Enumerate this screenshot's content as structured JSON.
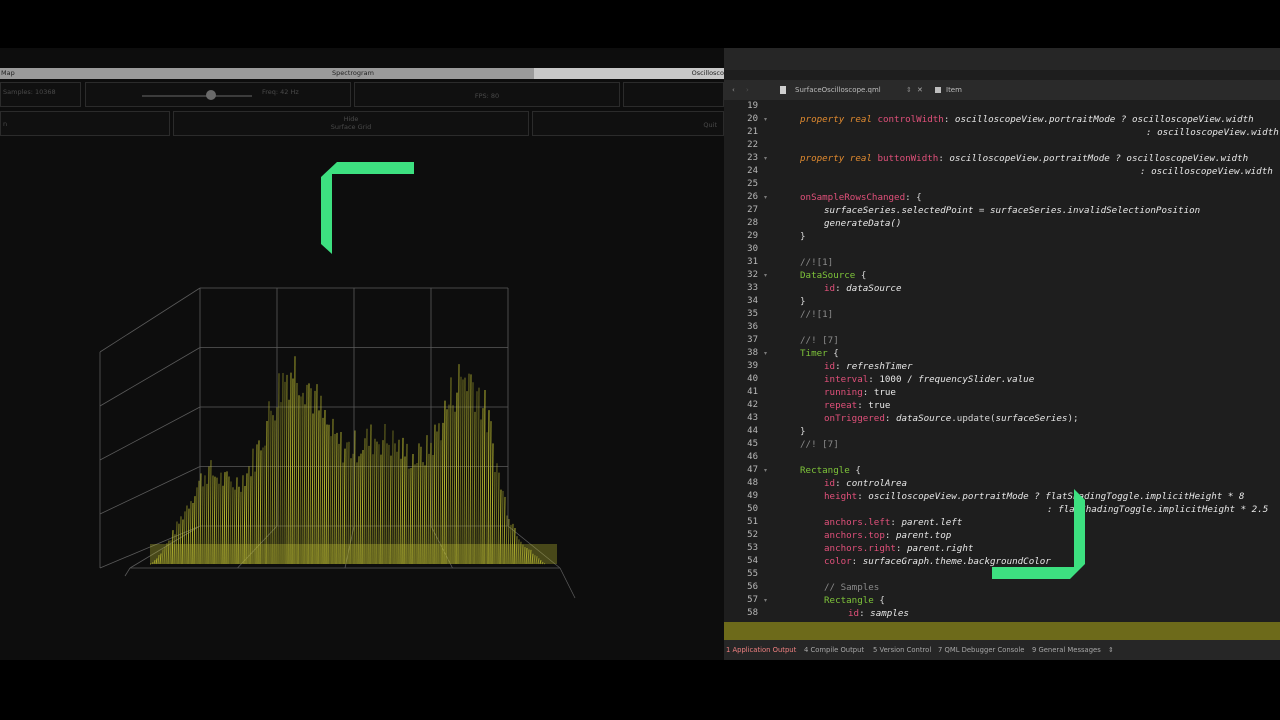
{
  "left_app": {
    "tabs": [
      "Map",
      "Spectrogram",
      "Oscillosco"
    ],
    "samples_label": "Samples: 10368",
    "frequency_label": "Freq: 42 Hz",
    "fps_label": "FPS: 80",
    "mode_label": "n",
    "hide_label": "Hide",
    "surface_grid_label": "Surface Grid",
    "quit_label": "Quit",
    "frequency_slider_value": 0.63
  },
  "editor": {
    "file_name": "SurfaceOscilloscope.qml",
    "item_label": "Item",
    "nav_back": "‹",
    "nav_fwd": "›",
    "chevron": "⇕",
    "close_glyph": "✕",
    "line_numbers": [
      "19",
      "20",
      "21",
      "22",
      "23",
      "24",
      "25",
      "26",
      "27",
      "28",
      "29",
      "30",
      "31",
      "32",
      "33",
      "34",
      "35",
      "36",
      "37",
      "38",
      "39",
      "40",
      "41",
      "42",
      "43",
      "44",
      "45",
      "46",
      "47",
      "48",
      "49",
      "50",
      "51",
      "52",
      "53",
      "54",
      "55",
      "56",
      "57",
      "58"
    ],
    "fold_marker": "▾",
    "code": {
      "l20_kw": "property real ",
      "l20_name": "controlWidth",
      "l20_colon": ": ",
      "l20_var": "oscilloscopeView.portraitMode",
      "l20_rest": " ? oscilloscopeView.width",
      "l21": ": oscilloscopeView.width",
      "l23_kw": "property real ",
      "l23_name": "buttonWidth",
      "l23_colon": ": ",
      "l23_var": "oscilloscopeView.portraitMode",
      "l23_rest": " ? oscilloscopeView.width",
      "l24": ": oscilloscopeView.width",
      "l26_prop": "onSampleRowsChanged",
      "l26_rest": ": {",
      "l27_var": "surfaceSeries.selectedPoint",
      "l27_mid": " = ",
      "l27_rest": "surfaceSeries.invalidSelectionPosition",
      "l28": "generateData()",
      "l29": "}",
      "l31": "//![1]",
      "l32_typ": "DataSource",
      "l32_rest": " {",
      "l33_prop": "id",
      "l33_colon": ": ",
      "l33_val": "dataSource",
      "l34": "}",
      "l35": "//![1]",
      "l37": "//! [7]",
      "l38_typ": "Timer",
      "l38_rest": " {",
      "l39_prop": "id",
      "l39_colon": ": ",
      "l39_val": "refreshTimer",
      "l40_prop": "interval",
      "l40_colon": ": ",
      "l40_val": "1000 / ",
      "l40_var": "frequencySlider.value",
      "l41_prop": "running",
      "l41_colon": ": ",
      "l41_val": "true",
      "l42_prop": "repeat",
      "l42_colon": ": ",
      "l42_val": "true",
      "l43_prop": "onTriggered",
      "l43_colon": ": ",
      "l43_var": "dataSource",
      "l43_val": ".update(",
      "l43_var2": "surfaceSeries",
      "l43_end": ");",
      "l44": "}",
      "l45": "//! [7]",
      "l47_typ": "Rectangle",
      "l47_rest": " {",
      "l48_prop": "id",
      "l48_colon": ": ",
      "l48_val": "controlArea",
      "l49_prop": "height",
      "l49_colon": ": ",
      "l49_var": "oscilloscopeView.portraitMode",
      "l49_rest": " ? flatShadingToggle.implicitHeight * 8",
      "l50": ": flatShadingToggle.implicitHeight * 2.5",
      "l51_prop": "anchors.left",
      "l51_colon": ": ",
      "l51_val": "parent.left",
      "l52_prop": "anchors.top",
      "l52_colon": ": ",
      "l52_val": "parent.top",
      "l53_prop": "anchors.right",
      "l53_colon": ": ",
      "l53_val": "parent.right",
      "l54_prop": "color",
      "l54_colon": ": ",
      "l54_val": "surfaceGraph.theme.backgroundColor",
      "l56": "// Samples",
      "l57_typ": "Rectangle",
      "l57_rest": " {",
      "l58_prop": "id",
      "l58_colon": ": ",
      "l58_val": "samples"
    },
    "output_panes": [
      "1  Application Output",
      "4  Compile Output",
      "5  Version Control",
      "7  QML Debugger Console",
      "9  General Messages",
      "⇕"
    ]
  },
  "colors": {
    "accent_green": "#3de080",
    "surface_yellow": "#b8b830",
    "keyword_orange": "#e08a2f",
    "property_pink": "#e0507a",
    "type_green": "#7ec43a"
  }
}
